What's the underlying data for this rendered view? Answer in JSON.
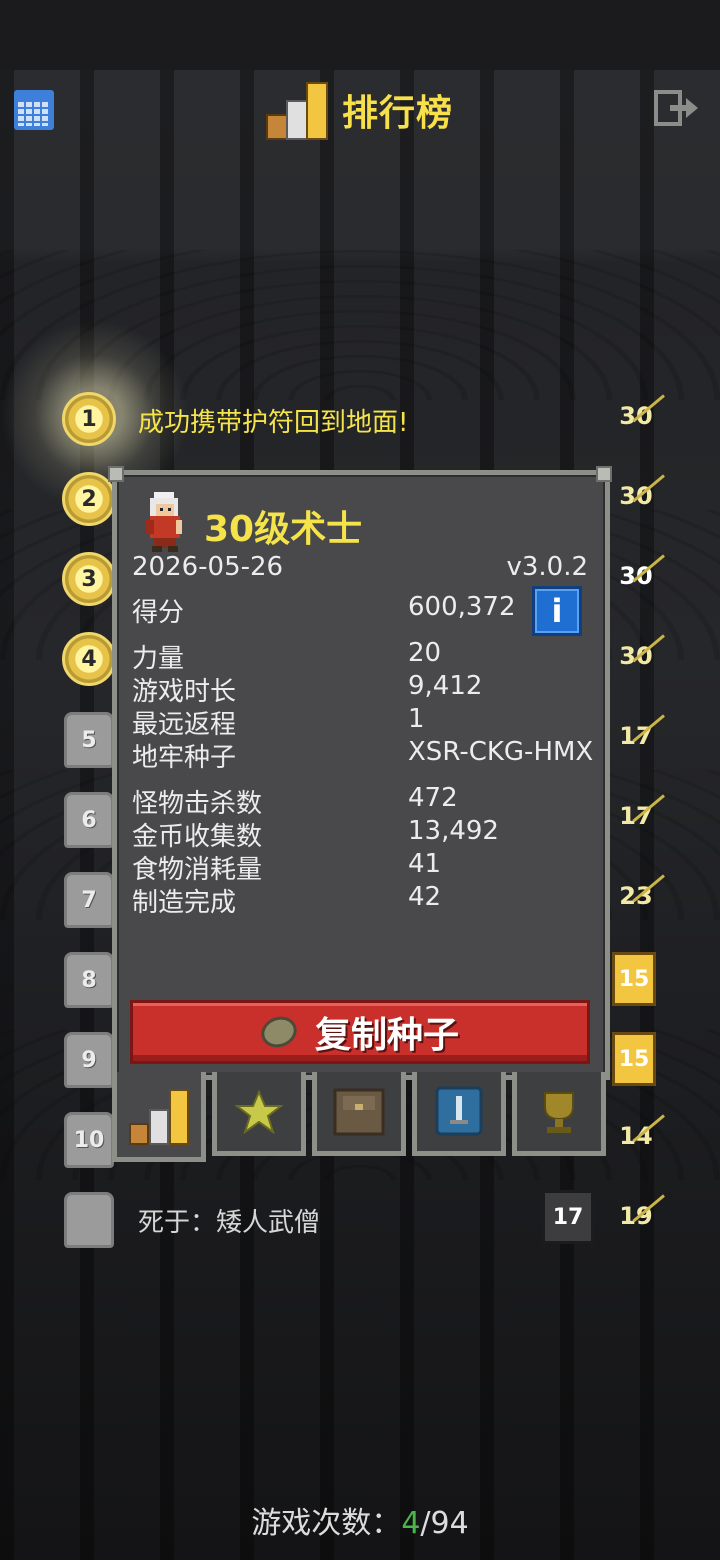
{
  "header": {
    "title": "排行榜"
  },
  "entries": [
    {
      "rank": "1",
      "text": "成功携带护符回到地面!",
      "level": "30",
      "badge": "gold"
    },
    {
      "rank": "2",
      "text": "",
      "level": "30",
      "badge": "gold"
    },
    {
      "rank": "3",
      "text": "",
      "level": "30",
      "badge": "gold"
    },
    {
      "rank": "4",
      "text": "",
      "level": "30",
      "badge": "gold"
    },
    {
      "rank": "5",
      "text": "",
      "level": "17",
      "badge": "stone"
    },
    {
      "rank": "6",
      "text": "",
      "level": "17",
      "badge": "stone"
    },
    {
      "rank": "7",
      "text": "",
      "level": "23",
      "badge": "stone"
    },
    {
      "rank": "8",
      "text": "",
      "floor": "15",
      "badge": "stone"
    },
    {
      "rank": "9",
      "text": "",
      "floor": "15",
      "badge": "stone"
    },
    {
      "rank": "10",
      "text": "",
      "level": "14",
      "badge": "stone"
    },
    {
      "rank": "",
      "text": "死于：矮人武僧",
      "floor": "17",
      "level": "19",
      "badge": "stone"
    }
  ],
  "dialog": {
    "title": "30级术士",
    "date": "2026-05-26",
    "version": "v3.0.2",
    "score_label": "得分",
    "score_value": "600,372",
    "info_label": "i",
    "stats": [
      {
        "label": "力量",
        "value": "20"
      },
      {
        "label": "游戏时长",
        "value": "9,412"
      },
      {
        "label": "最远返程",
        "value": "1"
      },
      {
        "label": "地牢种子",
        "value": "XSR-CKG-HMX"
      }
    ],
    "stats2": [
      {
        "label": "怪物击杀数",
        "value": "472"
      },
      {
        "label": "金币收集数",
        "value": "13,492"
      },
      {
        "label": "食物消耗量",
        "value": "41"
      },
      {
        "label": "制造完成",
        "value": "42"
      }
    ],
    "copy_button": "复制种子",
    "tabs": [
      "stats-tab",
      "badges-tab",
      "items-tab",
      "talents-tab",
      "trophy-tab"
    ]
  },
  "footer": {
    "label": "游戏次数：",
    "current": "4",
    "total": "/94"
  },
  "colors": {
    "title_yellow": "#f5e34a",
    "copy_red": "#c9302c",
    "info_blue": "#1f6ed1",
    "current_green": "#49b649"
  }
}
